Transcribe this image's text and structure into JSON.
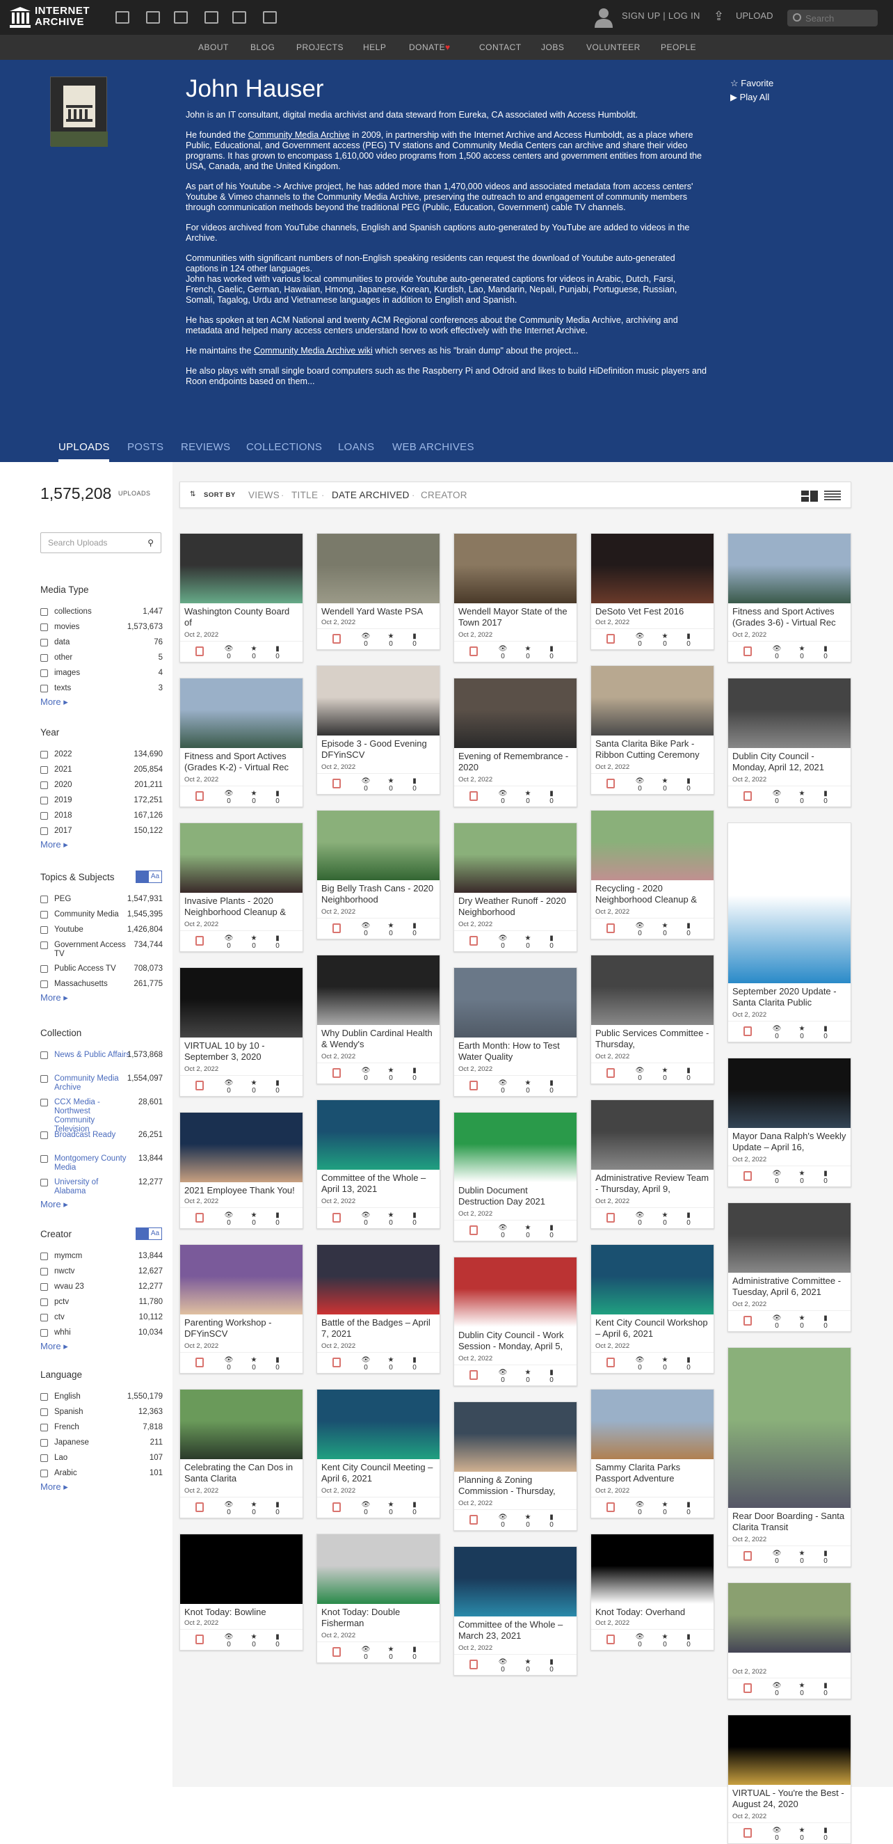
{
  "header": {
    "logo_line1": "INTERNET",
    "logo_line2": "ARCHIVE",
    "signup": "SIGN UP | LOG IN",
    "upload": "UPLOAD",
    "search_placeholder": "Search"
  },
  "nav": [
    "ABOUT",
    "BLOG",
    "PROJECTS",
    "HELP",
    "DONATE",
    "CONTACT",
    "JOBS",
    "VOLUNTEER",
    "PEOPLE"
  ],
  "hero": {
    "name": "John Hauser",
    "p1": "John is an IT consultant, digital media archivist and data steward from Eureka, CA associated with Access Humboldt.",
    "p2a": "He founded the ",
    "p2link": "Community Media Archive",
    "p2b": " in 2009, in partnership with the Internet Archive and Access Humboldt, as a place where Public, Educational, and Government access (PEG) TV stations and Community Media Centers can archive and share their video programs. It has grown to encompass 1,610,000 video programs from 1,500 access centers and government entities from around the USA, Canada, and the United Kingdom.",
    "p3": "As part of his Youtube -> Archive project, he has added more than 1,470,000 videos and associated metadata from access centers' Youtube & Vimeo channels to the Community Media Archive, preserving the outreach to and engagement of community members through communication methods beyond the traditional PEG (Public, Education, Government) cable TV channels.",
    "p4": "For videos archived from YouTube channels, English and Spanish captions auto-generated by YouTube are added to videos in the Archive.",
    "p5": "Communities with significant numbers of non-English speaking residents can request the download of Youtube auto-generated captions in 124 other languages.",
    "p5b": "John has worked with various local communities to provide Youtube auto-generated captions for videos in Arabic, Dutch, Farsi, French, Gaelic, German, Hawaiian, Hmong, Japanese, Korean, Kurdish, Lao, Mandarin, Nepali, Punjabi, Portuguese, Russian, Somali, Tagalog, Urdu and Vietnamese languages in addition to English and Spanish.",
    "p6": "He has spoken at ten ACM National and twenty ACM Regional conferences about the Community Media Archive, archiving and metadata and helped many access centers understand how to work effectively with the Internet Archive.",
    "p7a": "He maintains the ",
    "p7link": "Community Media Archive wiki",
    "p7b": " which serves as his \"brain dump\" about the project...",
    "p8": "He also plays with small single board computers such as the Raspberry Pi and Odroid and likes to build HiDefinition music players and Roon endpoints based on them...",
    "favorite": "Favorite",
    "playall": "Play All"
  },
  "tabs": [
    "UPLOADS",
    "POSTS",
    "REVIEWS",
    "COLLECTIONS",
    "LOANS",
    "WEB ARCHIVES"
  ],
  "summary": {
    "count": "1,575,208",
    "label": "UPLOADS",
    "search_placeholder": "Search Uploads"
  },
  "facets": [
    {
      "title": "Media Type",
      "rows": [
        [
          "collections",
          "1,447"
        ],
        [
          "movies",
          "1,573,673"
        ],
        [
          "data",
          "76"
        ],
        [
          "other",
          "5"
        ],
        [
          "images",
          "4"
        ],
        [
          "texts",
          "3"
        ]
      ]
    },
    {
      "title": "Year",
      "rows": [
        [
          "2022",
          "134,690"
        ],
        [
          "2021",
          "205,854"
        ],
        [
          "2020",
          "201,211"
        ],
        [
          "2019",
          "172,251"
        ],
        [
          "2018",
          "167,126"
        ],
        [
          "2017",
          "150,122"
        ]
      ]
    },
    {
      "title": "Topics & Subjects",
      "rows": [
        [
          "PEG",
          "1,547,931"
        ],
        [
          "Community Media",
          "1,545,395"
        ],
        [
          "Youtube",
          "1,426,804"
        ],
        [
          "Government Access TV",
          "734,744"
        ],
        [
          "Public Access TV",
          "708,073"
        ],
        [
          "Massachusetts",
          "261,775"
        ]
      ]
    },
    {
      "title": "Collection",
      "rows": [
        [
          "News & Public Affairs",
          "1,573,868"
        ],
        [
          "Community Media Archive",
          "1,554,097"
        ],
        [
          "CCX Media - Northwest Community Television",
          "28,601"
        ],
        [
          "Broadcast Ready",
          "26,251"
        ],
        [
          "Montgomery County Media",
          "13,844"
        ],
        [
          "University of Alabama",
          "12,277"
        ]
      ]
    },
    {
      "title": "Creator",
      "rows": [
        [
          "mymcm",
          "13,844"
        ],
        [
          "nwctv",
          "12,627"
        ],
        [
          "wvau 23",
          "12,277"
        ],
        [
          "pctv",
          "11,780"
        ],
        [
          "ctv",
          "10,112"
        ],
        [
          "whhi",
          "10,034"
        ]
      ]
    },
    {
      "title": "Language",
      "rows": [
        [
          "English",
          "1,550,179"
        ],
        [
          "Spanish",
          "12,363"
        ],
        [
          "French",
          "7,818"
        ],
        [
          "Japanese",
          "211"
        ],
        [
          "Lao",
          "107"
        ],
        [
          "Arabic",
          "101"
        ]
      ]
    }
  ],
  "more_label": "More",
  "az_label": [
    "",
    "Aa"
  ],
  "sort": {
    "label": "SORT BY",
    "options": [
      "VIEWS",
      "TITLE",
      "DATE ARCHIVED",
      "CREATOR"
    ]
  },
  "tiles": [
    [
      "Washington County Board of",
      "Oct 2, 2022"
    ],
    [
      "Wendell Yard Waste PSA",
      "Oct 2, 2022"
    ],
    [
      "Wendell Mayor State of the Town 2017",
      "Oct 2, 2022"
    ],
    [
      "DeSoto Vet Fest 2016",
      "Oct 2, 2022"
    ],
    [
      "Fitness and Sport Actives (Grades 3-6) - Virtual Rec",
      "Oct 2, 2022"
    ],
    [
      "Fitness and Sport Actives (Grades K-2) - Virtual Rec",
      "Oct 2, 2022"
    ],
    [
      "Episode 3 - Good Evening DFYinSCV",
      "Oct 2, 2022"
    ],
    [
      "Evening of Remembrance - 2020",
      "Oct 2, 2022"
    ],
    [
      "Santa Clarita Bike Park - Ribbon Cutting Ceremony",
      "Oct 2, 2022"
    ],
    [
      "Dublin City Council - Monday, April 12, 2021",
      "Oct 2, 2022"
    ],
    [
      "Invasive Plants - 2020 Neighborhood Cleanup &",
      "Oct 2, 2022"
    ],
    [
      "Big Belly Trash Cans - 2020 Neighborhood",
      "Oct 2, 2022"
    ],
    [
      "Dry Weather Runoff - 2020 Neighborhood",
      "Oct 2, 2022"
    ],
    [
      "Recycling - 2020 Neighborhood Cleanup &",
      "Oct 2, 2022"
    ],
    [
      "September 2020 Update - Santa Clarita Public",
      "Oct 2, 2022"
    ],
    [
      "VIRTUAL 10 by 10 - September 3, 2020",
      "Oct 2, 2022"
    ],
    [
      "Why Dublin Cardinal Health & Wendy's",
      "Oct 2, 2022"
    ],
    [
      "Earth Month: How to Test Water Quality",
      "Oct 2, 2022"
    ],
    [
      "Public Services Committee - Thursday,",
      "Oct 2, 2022"
    ],
    [
      "Mayor Dana Ralph's Weekly Update – April 16,",
      "Oct 2, 2022"
    ],
    [
      "2021 Employee Thank You!",
      "Oct 2, 2022"
    ],
    [
      "Committee of the Whole – April 13, 2021",
      "Oct 2, 2022"
    ],
    [
      "Dublin Document Destruction Day 2021",
      "Oct 2, 2022"
    ],
    [
      "Administrative Review Team - Thursday, April 9,",
      "Oct 2, 2022"
    ],
    [
      "Administrative Committee - Tuesday, April 6, 2021",
      "Oct 2, 2022"
    ],
    [
      "Parenting Workshop - DFYinSCV",
      "Oct 2, 2022"
    ],
    [
      "Battle of the Badges – April 7, 2021",
      "Oct 2, 2022"
    ],
    [
      "Dublin City Council - Work Session - Monday, April 5,",
      "Oct 2, 2022"
    ],
    [
      "Kent City Council Workshop – April 6, 2021",
      "Oct 2, 2022"
    ],
    [
      "Rear Door Boarding - Santa Clarita Transit",
      "Oct 2, 2022"
    ],
    [
      "Celebrating the Can Dos in Santa Clarita",
      "Oct 2, 2022"
    ],
    [
      "Kent City Council Meeting – April 6, 2021",
      "Oct 2, 2022"
    ],
    [
      "Planning & Zoning Commission - Thursday,",
      "Oct 2, 2022"
    ],
    [
      "Sammy Clarita Parks Passport Adventure",
      "Oct 2, 2022"
    ],
    [
      "",
      "Oct 2, 2022"
    ],
    [
      "Knot Today: Bowline",
      "Oct 2, 2022"
    ],
    [
      "Knot Today: Double Fisherman",
      "Oct 2, 2022"
    ],
    [
      "Committee of the Whole – March 23, 2021",
      "Oct 2, 2022"
    ],
    [
      "Knot Today: Overhand",
      "Oct 2, 2022"
    ],
    [
      "VIRTUAL - You're the Best - August 24, 2020",
      "Oct 2, 2022"
    ]
  ],
  "tile_stats": [
    "0",
    "0",
    "0"
  ]
}
